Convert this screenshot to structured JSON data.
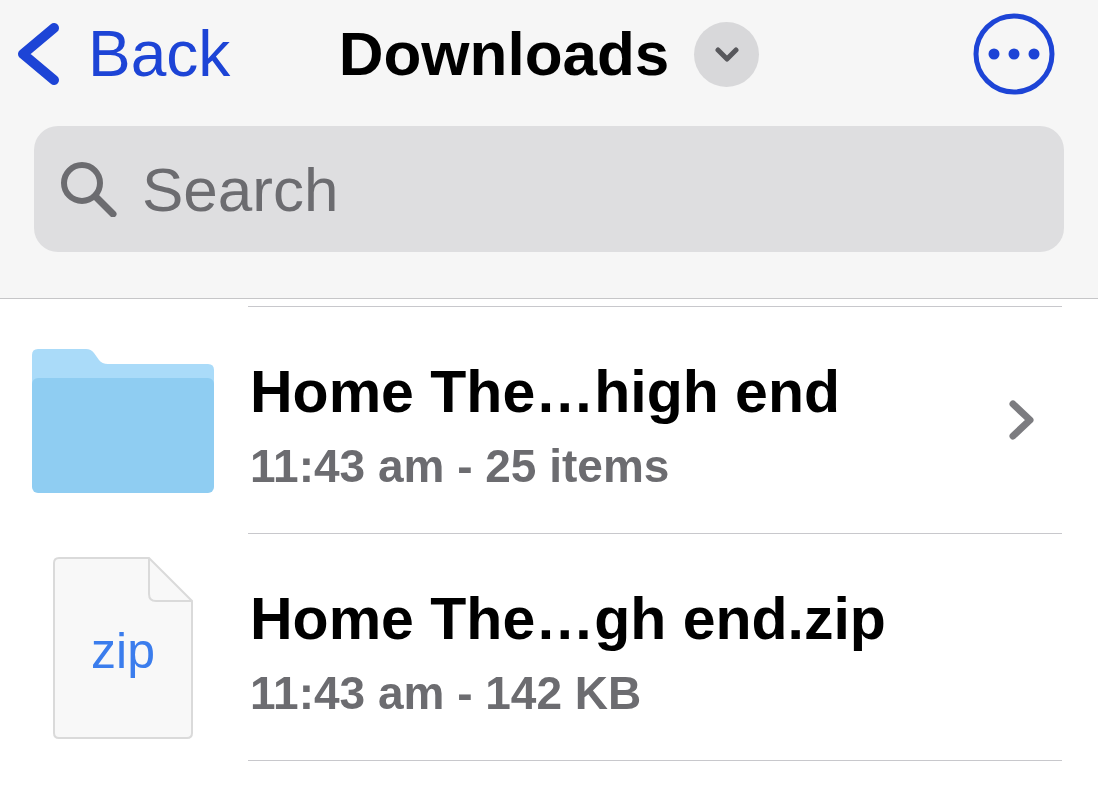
{
  "nav": {
    "back": "Back",
    "title": "Downloads"
  },
  "search": {
    "placeholder": "Search"
  },
  "items": [
    {
      "kind": "folder",
      "name": "Home The…high end",
      "details": "11:43 am - 25 items"
    },
    {
      "kind": "file",
      "name": "Home The…gh end.zip",
      "details": "11:43 am - 142 KB",
      "icon_label": "zip"
    }
  ]
}
